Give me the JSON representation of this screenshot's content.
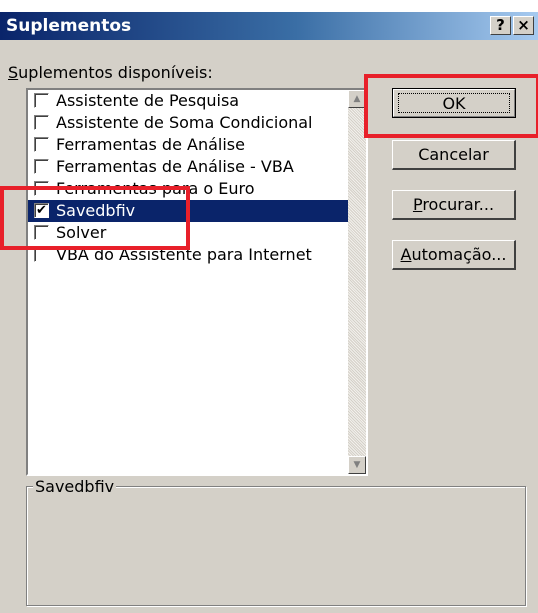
{
  "window": {
    "title": "Suplementos",
    "help_button": "?",
    "close_button": "×"
  },
  "available_label": {
    "first": "S",
    "rest": "uplementos disponíveis:"
  },
  "addins": [
    {
      "label": "Assistente de Pesquisa",
      "checked": false,
      "selected": false
    },
    {
      "label": "Assistente de Soma Condicional",
      "checked": false,
      "selected": false
    },
    {
      "label": "Ferramentas de Análise",
      "checked": false,
      "selected": false
    },
    {
      "label": "Ferramentas de Análise - VBA",
      "checked": false,
      "selected": false
    },
    {
      "label": "Ferramentas para o Euro",
      "checked": false,
      "selected": false
    },
    {
      "label": "Savedbfiv",
      "checked": true,
      "selected": true
    },
    {
      "label": "Solver",
      "checked": false,
      "selected": false
    },
    {
      "label": "VBA do Assistente para Internet",
      "checked": false,
      "selected": false
    }
  ],
  "buttons": {
    "ok": "OK",
    "cancel": "Cancelar",
    "browse": {
      "first": "P",
      "rest": "rocurar..."
    },
    "automation": {
      "first": "A",
      "rest": "utomação..."
    }
  },
  "description": {
    "title": "Savedbfiv",
    "text": ""
  },
  "colors": {
    "highlight_red": "#e8202a",
    "selection_blue": "#0a246a",
    "dialog_gray": "#d4d0c8"
  }
}
